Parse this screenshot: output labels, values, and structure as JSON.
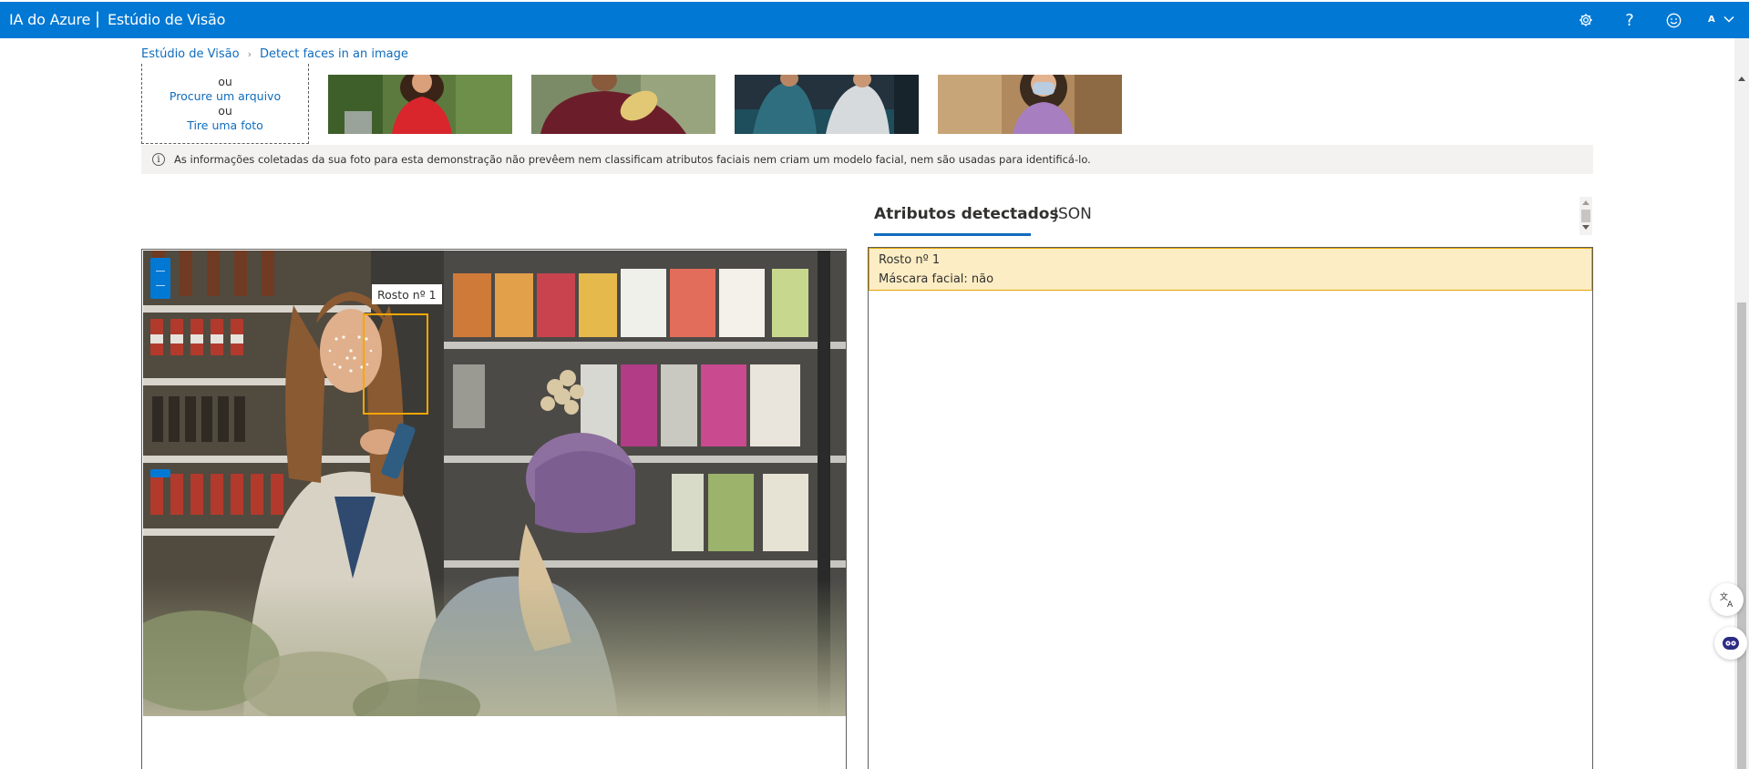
{
  "header": {
    "brand": "IA do Azure",
    "separator": "|",
    "product": "Estúdio de Visão",
    "icons": [
      "settings-icon",
      "help-icon",
      "feedback-smiley-icon"
    ],
    "avatar_initial": "A"
  },
  "breadcrumb": {
    "items": [
      "Estúdio de Visão",
      "Detect faces in an image"
    ]
  },
  "upload": {
    "line_ou_1": "ou",
    "browse_link": "Procure um arquivo",
    "line_ou_2": "ou",
    "photo_link": "Tire uma foto"
  },
  "samples": [
    "sample-woman-red-dress",
    "sample-man-burgundy-shirt",
    "sample-people-sitting",
    "sample-woman-face-mask"
  ],
  "info": {
    "text": "As informações coletadas da sua foto para esta demonstração não prevêem nem classificam atributos faciais nem criam um modelo facial, nem são usadas para identificá-lo."
  },
  "image": {
    "face_tag": "Rosto nº 1",
    "face_box_color": "#f7a600"
  },
  "tabs": [
    {
      "label": "Atributos detectados",
      "active": true
    },
    {
      "label": "JSON",
      "active": false
    }
  ],
  "results": [
    {
      "title": "Rosto nº 1",
      "attribute": "Máscara facial: não"
    }
  ],
  "colors": {
    "accent": "#0078d4",
    "link": "#0f6cbd",
    "highlight_bg": "#fdedc4",
    "highlight_border": "#e3a400"
  }
}
